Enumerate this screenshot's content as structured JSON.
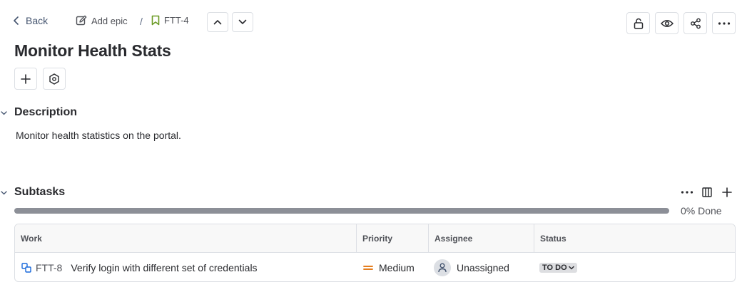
{
  "header": {
    "back_label": "Back",
    "add_epic_label": "Add epic",
    "breadcrumb_separator": "/",
    "issue_key": "FTT-4",
    "actions": [
      "lock-icon",
      "eye-icon",
      "share-icon",
      "more-icon"
    ]
  },
  "issue": {
    "title": "Monitor Health Stats"
  },
  "description": {
    "heading": "Description",
    "text": "Monitor health statistics on the portal."
  },
  "subtasks": {
    "heading": "Subtasks",
    "progress_percent": 0,
    "progress_label": "0% Done",
    "columns": [
      "Work",
      "Priority",
      "Assignee",
      "Status"
    ],
    "rows": [
      {
        "key": "FTT-8",
        "summary": "Verify login with different set of credentials",
        "priority": "Medium",
        "assignee": "Unassigned",
        "status": "TO DO"
      }
    ]
  },
  "colors": {
    "accent_blue": "#1868db",
    "priority_medium": "#e06c00",
    "progress_track": "#8c8f97",
    "story_green": "#4bce97"
  }
}
